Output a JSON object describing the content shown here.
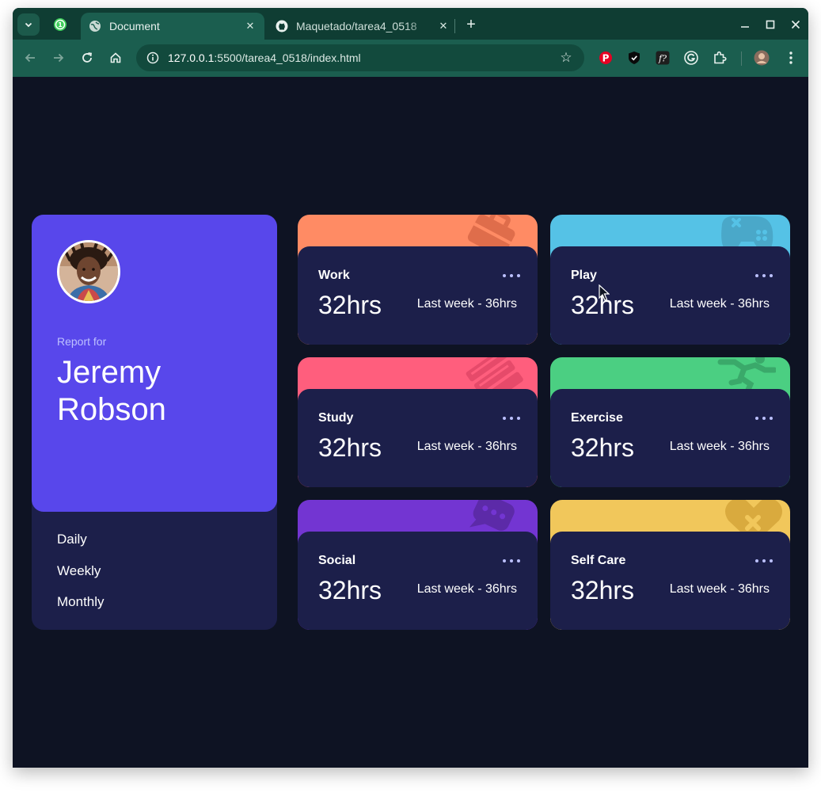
{
  "browser": {
    "tabs": [
      {
        "title": "Document",
        "active": true,
        "icon": "globe-icon"
      },
      {
        "title": "Maquetado/tarea4_0518",
        "active": false,
        "icon": "github-icon"
      }
    ],
    "url_host": "127.0.0.1",
    "url_rest": ":5500/tarea4_0518/index.html",
    "accent_color": "#1b5e4f"
  },
  "profile": {
    "report_for": "Report for",
    "name": "Jeremy Robson",
    "avatar_icon": "user-photo"
  },
  "periods": [
    "Daily",
    "Weekly",
    "Monthly"
  ],
  "activities": [
    {
      "title": "Work",
      "hours": "32hrs",
      "previous": "Last week - 36hrs",
      "color": "#ff8b64",
      "icon": "briefcase-icon"
    },
    {
      "title": "Play",
      "hours": "32hrs",
      "previous": "Last week - 36hrs",
      "color": "#55c2e6",
      "icon": "gamepad-icon"
    },
    {
      "title": "Study",
      "hours": "32hrs",
      "previous": "Last week - 36hrs",
      "color": "#ff5e7d",
      "icon": "books-icon"
    },
    {
      "title": "Exercise",
      "hours": "32hrs",
      "previous": "Last week - 36hrs",
      "color": "#4bcf82",
      "icon": "runner-icon"
    },
    {
      "title": "Social",
      "hours": "32hrs",
      "previous": "Last week - 36hrs",
      "color": "#7335d2",
      "icon": "chat-icon"
    },
    {
      "title": "Self Care",
      "hours": "32hrs",
      "previous": "Last week - 36hrs",
      "color": "#f1c75b",
      "icon": "heart-icon"
    }
  ]
}
